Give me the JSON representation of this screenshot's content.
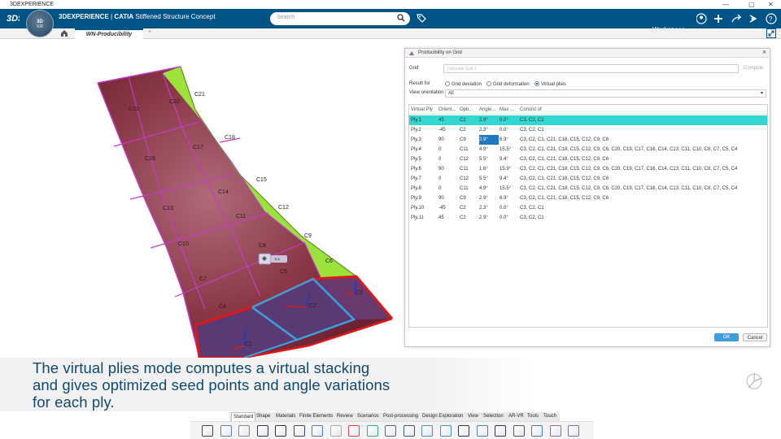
{
  "os_title": "3DEXPERIENCE",
  "app": {
    "brand": "3DEXPERIENCE",
    "separator": " | ",
    "product": "CATIA",
    "document": "Stiffened Structure Concept",
    "compass_label": "3D",
    "compass_version": "V.R"
  },
  "search": {
    "placeholder": "Search"
  },
  "header": {
    "workspace_label": "Workspace"
  },
  "tabs": {
    "home_icon": "home-icon",
    "active_tab": "WN-Producibility",
    "add_tab": "+"
  },
  "dialog": {
    "title": "Producibility on Grid",
    "grid_label": "Grid",
    "grid_value": "Laminate Grid 1",
    "compute_label": "Compute",
    "result_for_label": "Result for",
    "options": [
      "Grid deviation",
      "Grid deformation",
      "Virtual plies"
    ],
    "selected_option": "Virtual plies",
    "view_orientation_label": "View orientation",
    "view_orientation_value": "All",
    "columns": [
      "Virtual Ply",
      "Orient...",
      "Opti...",
      "Angle...",
      "Max ...",
      "Consist of"
    ],
    "rows": [
      [
        "Ply.1",
        "45",
        "C2",
        "2.9°",
        "0.0°",
        "C3, C2, C1"
      ],
      [
        "Ply.2",
        "-45",
        "C2",
        "2.3°",
        "0.0°",
        "C3, C2, C1"
      ],
      [
        "Ply.3",
        "90",
        "C9",
        "2.9°",
        "6.9°",
        "C3, C2, C1, C21, C18, C15, C12, C9, C6"
      ],
      [
        "Ply.4",
        "0",
        "C11",
        "4.9°",
        "15.5°",
        "C3, C2, C1, C21, C18, C15, C12, C9, C6, C20, C19, C17, C16, C14, C13, C11, C10, C8, C7, C5, C4"
      ],
      [
        "Ply.5",
        "0",
        "C12",
        "5.5°",
        "9.4°",
        "C3, C2, C1, C21, C18, C15, C12, C9, C6"
      ],
      [
        "Ply.6",
        "90",
        "C11",
        "1.6°",
        "15.9°",
        "C3, C2, C1, C21, C18, C15, C12, C9, C6, C20, C19, C17, C16, C14, C13, C11, C10, C8, C7, C5, C4"
      ],
      [
        "Ply.7",
        "0",
        "C12",
        "5.5°",
        "9.4°",
        "C3, C2, C1, C21, C18, C15, C12, C9, C6"
      ],
      [
        "Ply.8",
        "0",
        "C11",
        "4.9°",
        "15.5°",
        "C3, C2, C1, C21, C18, C15, C12, C9, C6, C20, C19, C17, C16, C14, C13, C11, C10, C8, C7, C5, C4"
      ],
      [
        "Ply.9",
        "90",
        "C9",
        "2.9°",
        "6.9°",
        "C3, C2, C1, C21, C18, C15, C12, C9, C6"
      ],
      [
        "Ply.10",
        "-45",
        "C2",
        "2.3°",
        "0.0°",
        "C3, C2, C1"
      ],
      [
        "Ply.11",
        "45",
        "C2",
        "2.9°",
        "0.0°",
        "C3, C2, C1"
      ]
    ],
    "highlighted_row": 0,
    "ok_label": "OK",
    "cancel_label": "Cancel",
    "colors": {
      "highlight": "#33d6d0",
      "selected_cell": "#1e78c2",
      "ok": "#3d9ddd"
    }
  },
  "viewport": {
    "cell_labels": [
      "C19",
      "C20",
      "C21",
      "C16",
      "C17",
      "C18",
      "C13",
      "C14",
      "C15",
      "C11",
      "C12",
      "C10",
      "C9",
      "C8",
      "C7",
      "C5",
      "C6",
      "C4",
      "C3",
      "C2",
      "C1"
    ],
    "tooltip_text": ">>",
    "colors": {
      "composite": "#7d2c3a",
      "green_zone": "#9be33b",
      "red_edge": "#e01717",
      "blue_edge": "#3aa0e0",
      "grid_line": "#c33cc8"
    }
  },
  "caption": [
    "The virtual plies mode computes a virtual stacking",
    "and gives optimized seed points and angle variations",
    "for each ply."
  ],
  "toolbar": {
    "tabs": [
      "Standard",
      "Shape",
      "Materials",
      "Finite Elements",
      "Review",
      "Scenarios",
      "Post-processing",
      "Design Exploration",
      "View",
      "Selection",
      "AR-VR",
      "Tools",
      "Touch"
    ],
    "active_tab": "Standard",
    "icons": [
      "cut-icon",
      "copy-icon",
      "paste-icon",
      "undo-icon",
      "find-icon",
      "book-icon",
      "select-icon",
      "tools-icon",
      "palette-icon",
      "cube-icon",
      "table-icon",
      "formula-icon",
      "sync-icon",
      "swap-icon",
      "layer-icon",
      "layers-icon",
      "chart-icon",
      "build-icon",
      "fabric-icon",
      "ply-icon",
      "producibility-icon"
    ]
  }
}
